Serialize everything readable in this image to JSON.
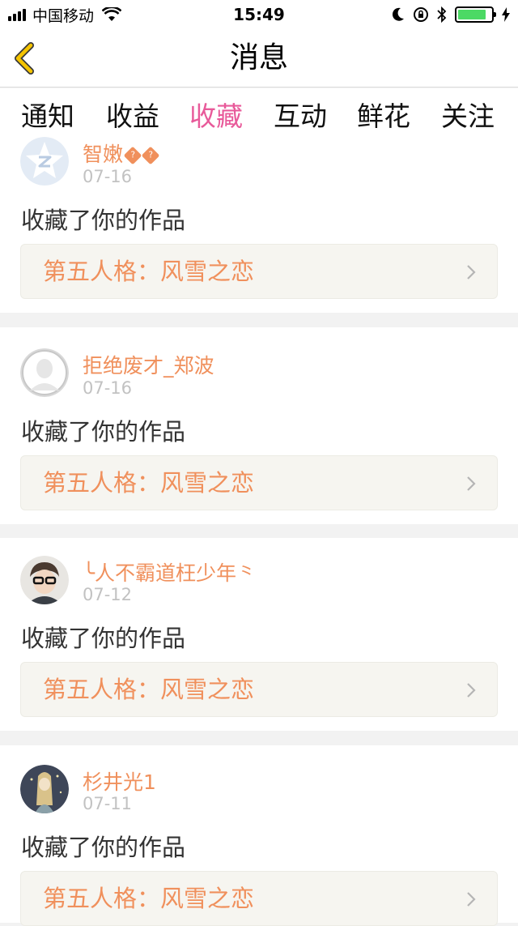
{
  "status_bar": {
    "carrier": "中国移动",
    "time": "15:49",
    "battery_level": 0.85,
    "colors": {
      "battery": "#4cd964"
    }
  },
  "nav": {
    "title": "消息",
    "back_icon": "chevron-left-icon",
    "accent": "#e8b400"
  },
  "tabs": [
    {
      "label": "通知",
      "active": false
    },
    {
      "label": "收益",
      "active": false
    },
    {
      "label": "收藏",
      "active": true
    },
    {
      "label": "互动",
      "active": false
    },
    {
      "label": "鲜花",
      "active": false
    },
    {
      "label": "关注",
      "active": false
    }
  ],
  "theme": {
    "active_tab": "#e85a9a",
    "name_color": "#f0905c",
    "date_color": "#c2c2c2"
  },
  "items": [
    {
      "user": "智嫩",
      "badges": [
        "?",
        "?"
      ],
      "date": "07-16",
      "action": "收藏了你的作品",
      "work_title": "第五人格：风雪之恋",
      "avatar": "qq-star-avatar"
    },
    {
      "user": "拒绝废才_郑波",
      "date": "07-16",
      "action": "收藏了你的作品",
      "work_title": "第五人格：风雪之恋",
      "avatar": "default-avatar"
    },
    {
      "user": "╰人不霸道枉少年⺀",
      "date": "07-12",
      "action": "收藏了你的作品",
      "work_title": "第五人格：风雪之恋",
      "avatar": "photo-avatar"
    },
    {
      "user": "杉井光1",
      "date": "07-11",
      "action": "收藏了你的作品",
      "work_title": "第五人格：风雪之恋",
      "avatar": "illustration-avatar"
    }
  ]
}
